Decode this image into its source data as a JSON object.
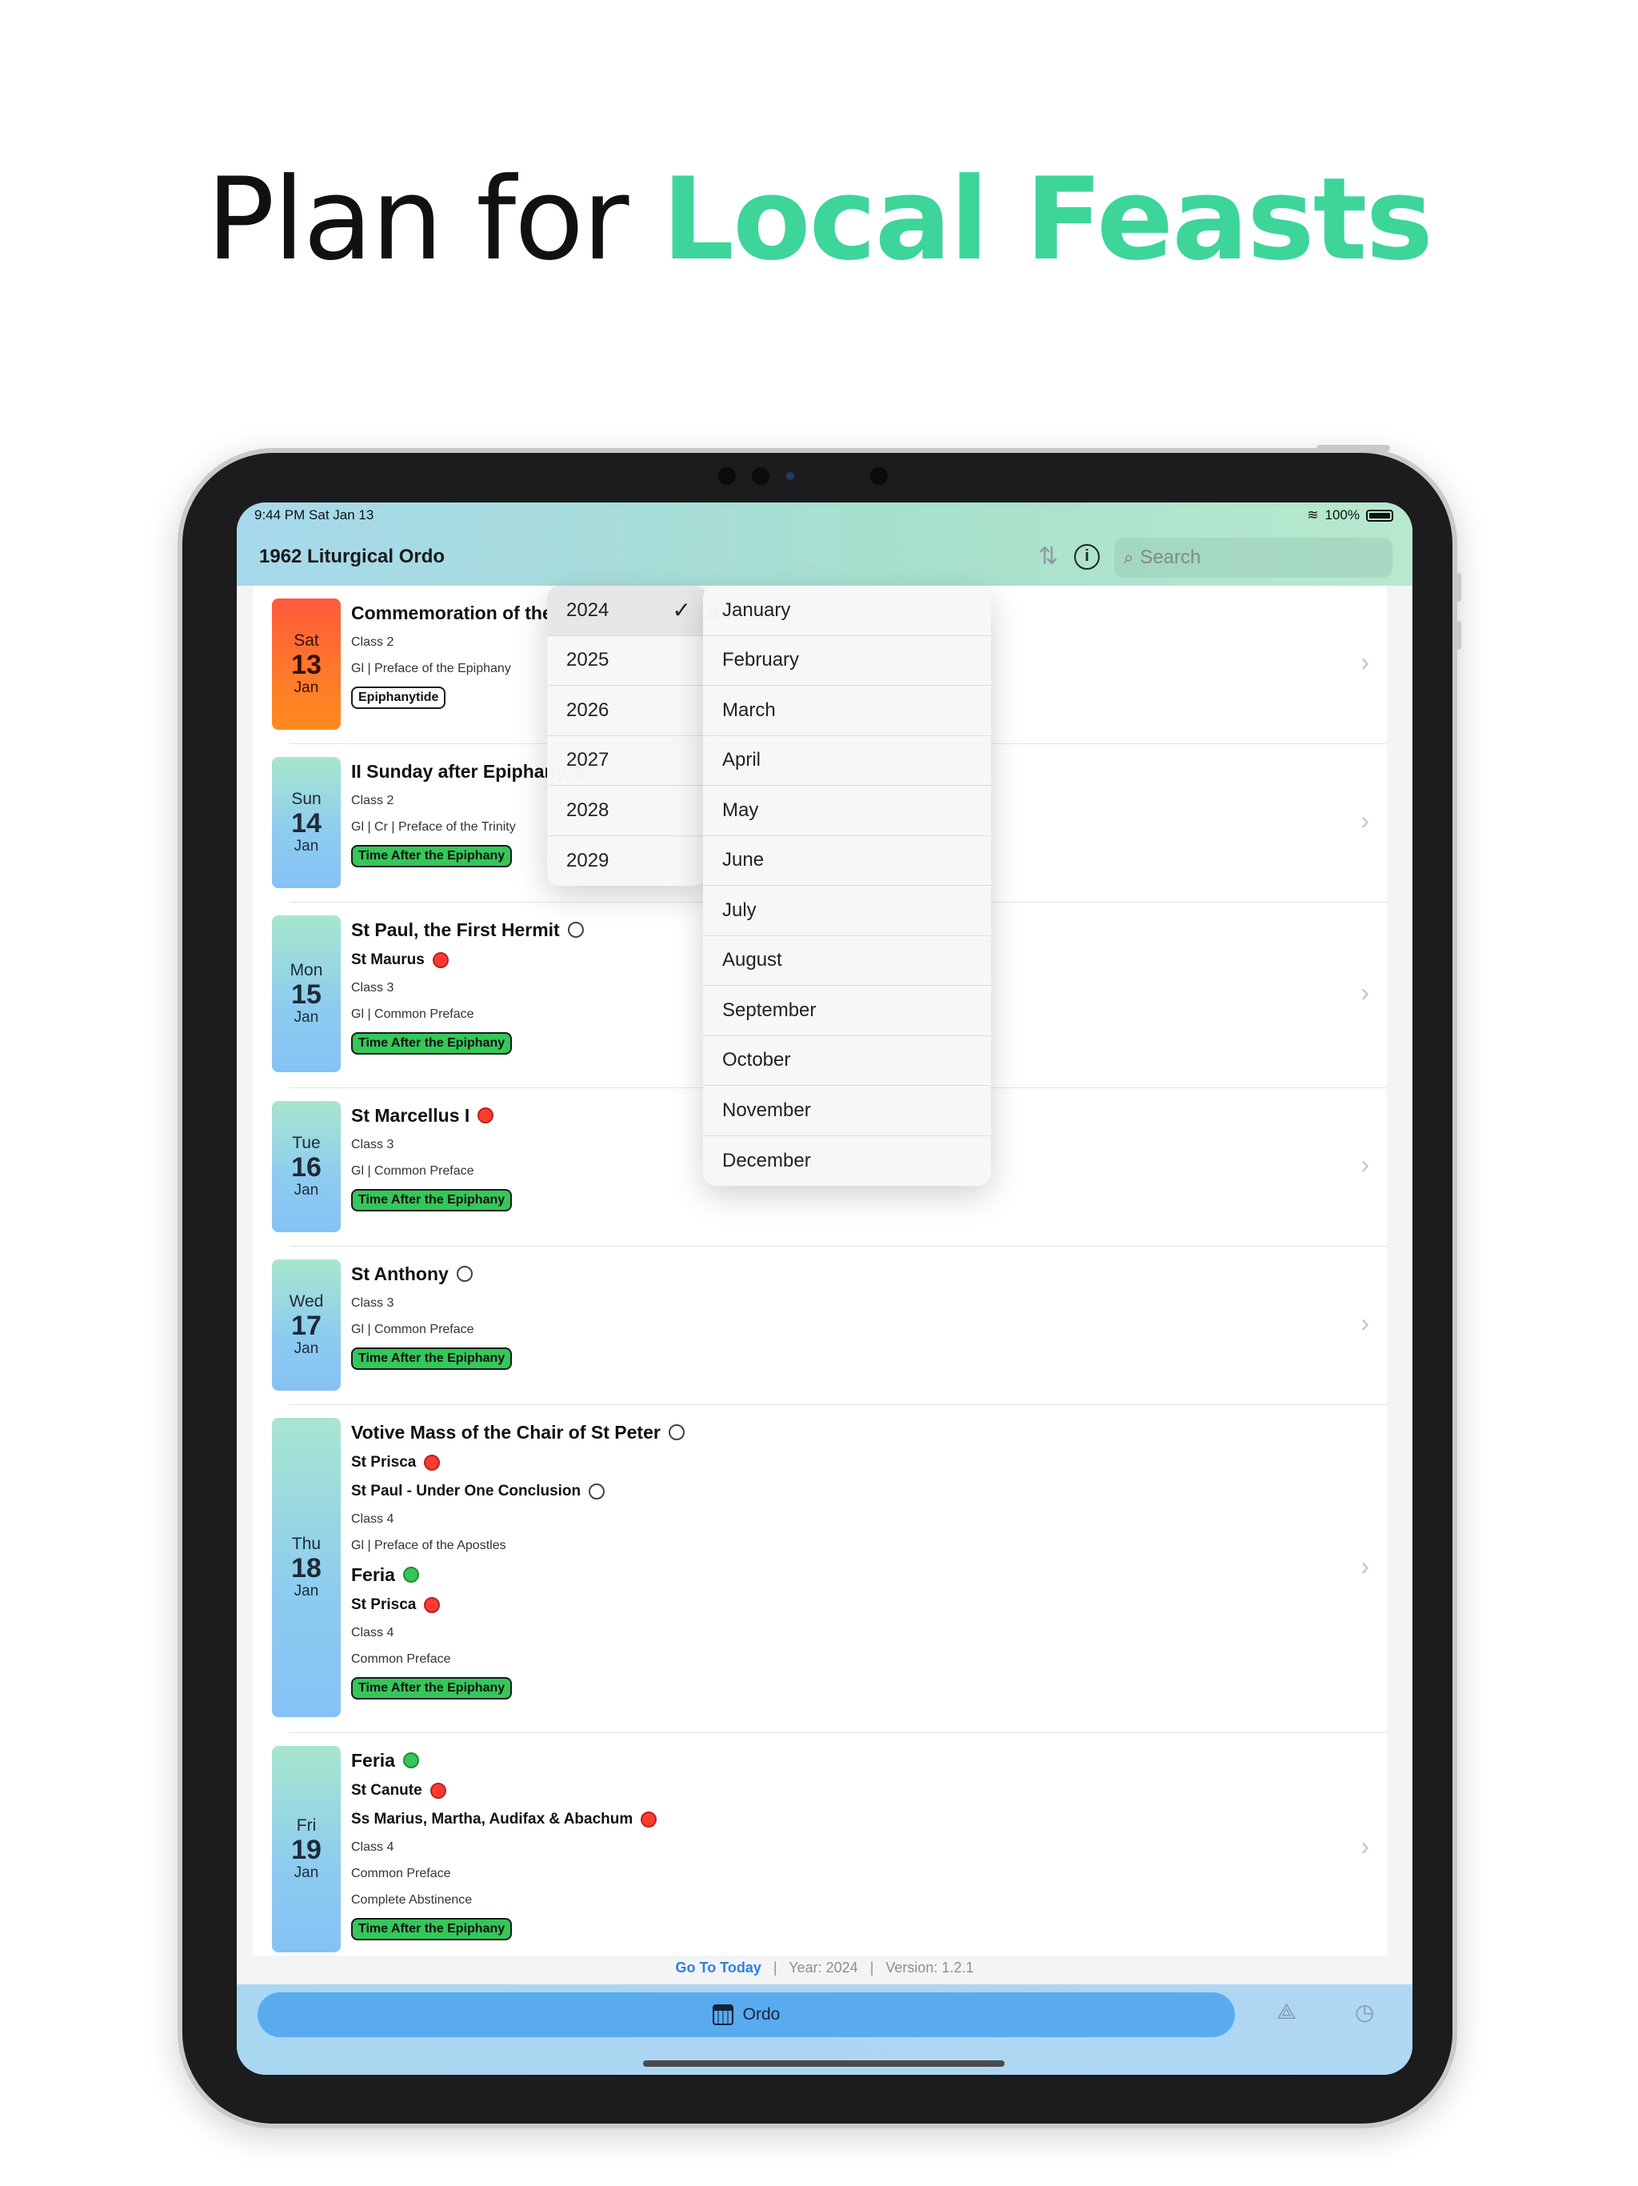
{
  "headline": {
    "plain": "Plan for ",
    "accent": "Local Feasts",
    "accent_color": "#3dd59a"
  },
  "status_bar": {
    "time_date": "9:44 PM   Sat Jan 13",
    "battery": "100%"
  },
  "nav": {
    "title": "1962 Liturgical Ordo",
    "search_placeholder": "Search",
    "info_glyph": "i",
    "sort_glyph": "⇅"
  },
  "year_menu": {
    "items": [
      "2024",
      "2025",
      "2026",
      "2027",
      "2028",
      "2029"
    ],
    "selected": "2024",
    "check": "✓"
  },
  "month_menu": {
    "items": [
      "January",
      "February",
      "March",
      "April",
      "May",
      "June",
      "July",
      "August",
      "September",
      "October",
      "November",
      "December"
    ]
  },
  "days": [
    {
      "dow": "Sat",
      "day": "13",
      "mon": "Jan",
      "lines": [
        {
          "kind": "title",
          "text": "Commemoration of the Baptism of the Lord",
          "dot": "white"
        },
        {
          "kind": "small",
          "text": "Class 2"
        },
        {
          "kind": "small",
          "text": "Gl | Preface of the Epiphany"
        },
        {
          "kind": "tag",
          "text": "Epiphanytide",
          "tag": "white"
        }
      ]
    },
    {
      "dow": "Sun",
      "day": "14",
      "mon": "Jan",
      "lines": [
        {
          "kind": "title",
          "text": "II Sunday after Epiphany",
          "dot": "green"
        },
        {
          "kind": "small",
          "text": "Class 2"
        },
        {
          "kind": "small",
          "text": "Gl | Cr | Preface of the Trinity"
        },
        {
          "kind": "tag",
          "text": "Time After the Epiphany",
          "tag": "green"
        }
      ]
    },
    {
      "dow": "Mon",
      "day": "15",
      "mon": "Jan",
      "lines": [
        {
          "kind": "title",
          "text": "St Paul, the First Hermit",
          "dot": "white"
        },
        {
          "kind": "sub",
          "text": "St Maurus",
          "dot": "red"
        },
        {
          "kind": "small",
          "text": "Class 3"
        },
        {
          "kind": "small",
          "text": "Gl | Common Preface"
        },
        {
          "kind": "tag",
          "text": "Time After the Epiphany",
          "tag": "green"
        }
      ]
    },
    {
      "dow": "Tue",
      "day": "16",
      "mon": "Jan",
      "lines": [
        {
          "kind": "title",
          "text": "St Marcellus I",
          "dot": "red"
        },
        {
          "kind": "small",
          "text": "Class 3"
        },
        {
          "kind": "small",
          "text": "Gl | Common Preface"
        },
        {
          "kind": "tag",
          "text": "Time After the Epiphany",
          "tag": "green"
        }
      ]
    },
    {
      "dow": "Wed",
      "day": "17",
      "mon": "Jan",
      "lines": [
        {
          "kind": "title",
          "text": "St Anthony",
          "dot": "white"
        },
        {
          "kind": "small",
          "text": "Class 3"
        },
        {
          "kind": "small",
          "text": "Gl | Common Preface"
        },
        {
          "kind": "tag",
          "text": "Time After the Epiphany",
          "tag": "green"
        }
      ]
    },
    {
      "dow": "Thu",
      "day": "18",
      "mon": "Jan",
      "lines": [
        {
          "kind": "title",
          "text": "Votive Mass of the Chair of St Peter",
          "dot": "white"
        },
        {
          "kind": "sub",
          "text": "St Prisca",
          "dot": "red"
        },
        {
          "kind": "sub",
          "text": "St Paul - Under One Conclusion",
          "dot": "white"
        },
        {
          "kind": "small",
          "text": "Class 4"
        },
        {
          "kind": "small",
          "text": "Gl | Preface of the Apostles"
        },
        {
          "kind": "title",
          "text": "Feria",
          "dot": "green"
        },
        {
          "kind": "sub",
          "text": "St Prisca",
          "dot": "red"
        },
        {
          "kind": "small",
          "text": "Class 4"
        },
        {
          "kind": "small",
          "text": "Common Preface"
        },
        {
          "kind": "tag",
          "text": "Time After the Epiphany",
          "tag": "green"
        }
      ]
    },
    {
      "dow": "Fri",
      "day": "19",
      "mon": "Jan",
      "lines": [
        {
          "kind": "title",
          "text": "Feria",
          "dot": "green"
        },
        {
          "kind": "sub",
          "text": "St Canute",
          "dot": "red"
        },
        {
          "kind": "sub",
          "text": "Ss Marius, Martha, Audifax & Abachum",
          "dot": "red"
        },
        {
          "kind": "small",
          "text": "Class 4"
        },
        {
          "kind": "small",
          "text": "Common Preface"
        },
        {
          "kind": "small",
          "text": "Complete Abstinence"
        },
        {
          "kind": "tag",
          "text": "Time After the Epiphany",
          "tag": "green"
        }
      ]
    }
  ],
  "footer": {
    "go_today": "Go To Today",
    "sep": "|",
    "year": "Year: 2024",
    "version": "Version: 1.2.1"
  },
  "tabbar": {
    "ordo_label": "Ordo",
    "tab2_icon": "triangle-nodes-icon",
    "tab3_icon": "clock-icon"
  },
  "colors": {
    "green_tag": "#34c759",
    "red_dot": "#ff3b30",
    "link": "#2f7fe0"
  }
}
